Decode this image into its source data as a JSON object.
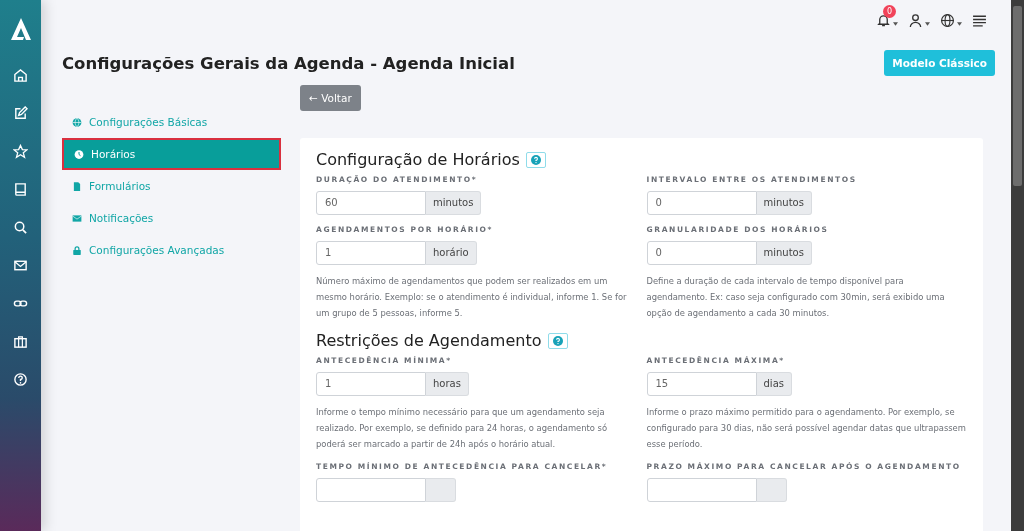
{
  "topbar": {
    "notification_count": "0"
  },
  "page_title": "Configurações Gerais da Agenda - Agenda Inicial",
  "classic_button": "Modelo Clássico",
  "back_button": "← Voltar",
  "nav": [
    {
      "label": "Configurações Básicas",
      "selected": false
    },
    {
      "label": "Horários",
      "selected": true
    },
    {
      "label": "Formulários",
      "selected": false
    },
    {
      "label": "Notificações",
      "selected": false
    },
    {
      "label": "Configurações Avançadas",
      "selected": false
    }
  ],
  "sections": [
    {
      "title": "Configuração de Horários",
      "fields": [
        {
          "label": "DURAÇÃO DO ATENDIMENTO*",
          "value": "60",
          "unit": "minutos"
        },
        {
          "label": "INTERVALO ENTRE OS ATENDIMENTOS",
          "value": "0",
          "unit": "minutos"
        },
        {
          "label": "AGENDAMENTOS POR HORÁRIO*",
          "value": "1",
          "unit": "horário",
          "help": "Número máximo de agendamentos que podem ser realizados em um mesmo horário. Exemplo: se o atendimento é individual, informe 1. Se for um grupo de 5 pessoas, informe 5."
        },
        {
          "label": "GRANULARIDADE DOS HORÁRIOS",
          "value": "0",
          "unit": "minutos",
          "help": "Define a duração de cada intervalo de tempo disponível para agendamento. Ex: caso seja configurado com 30min, será exibido uma opção de agendamento a cada 30 minutos."
        }
      ]
    },
    {
      "title": "Restrições de Agendamento",
      "fields": [
        {
          "label": "ANTECEDÊNCIA MÍNIMA*",
          "value": "1",
          "unit": "horas",
          "help": "Informe o tempo mínimo necessário para que um agendamento seja realizado. Por exemplo, se definido para 24 horas, o agendamento só poderá ser marcado a partir de 24h após o horário atual."
        },
        {
          "label": "ANTECEDÊNCIA MÁXIMA*",
          "value": "15",
          "unit": "dias",
          "help": "Informe o prazo máximo permitido para o agendamento. Por exemplo, se configurado para 30 dias, não será possível agendar datas que ultrapassem esse período."
        },
        {
          "label": "TEMPO MÍNIMO DE ANTECEDÊNCIA PARA CANCELAR*"
        },
        {
          "label": "PRAZO MÁXIMO PARA CANCELAR APÓS O AGENDAMENTO"
        }
      ]
    }
  ]
}
